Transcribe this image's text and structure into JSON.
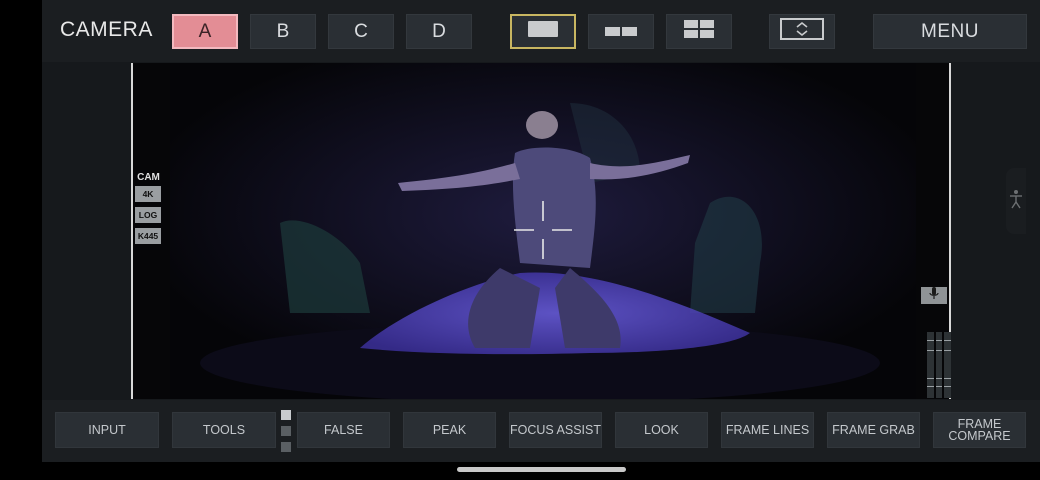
{
  "app": {
    "title": "CAMERA"
  },
  "camera_select": [
    {
      "label": "A",
      "selected": true
    },
    {
      "label": "B",
      "selected": false
    },
    {
      "label": "C",
      "selected": false
    },
    {
      "label": "D",
      "selected": false
    }
  ],
  "view_layouts": [
    {
      "icon": "single-view-icon",
      "selected": true
    },
    {
      "icon": "dual-view-icon",
      "selected": false
    },
    {
      "icon": "quad-view-icon",
      "selected": false
    }
  ],
  "toolbar": {
    "fullscreen_icon": "expand-vertical-icon",
    "menu_label": "MENU"
  },
  "monitor_overlay": {
    "header": "CAM",
    "tags": [
      "4K",
      "LOG",
      "K445"
    ]
  },
  "audio": {
    "mic_icon": "microphone-icon"
  },
  "bottom_tools": {
    "input": "INPUT",
    "tools": "TOOLS",
    "false": "FALSE",
    "peak": "PEAK",
    "focus_assist": "FOCUS ASSIST",
    "look": "LOOK",
    "frame_lines": "FRAME LINES",
    "frame_grab": "FRAME GRAB",
    "frame_compare": "FRAME COMPARE"
  },
  "colors": {
    "accent_selected_camera": "#e38d95",
    "accent_selected_layout": "#c8b661",
    "stage_light": "#4b3fb8"
  }
}
